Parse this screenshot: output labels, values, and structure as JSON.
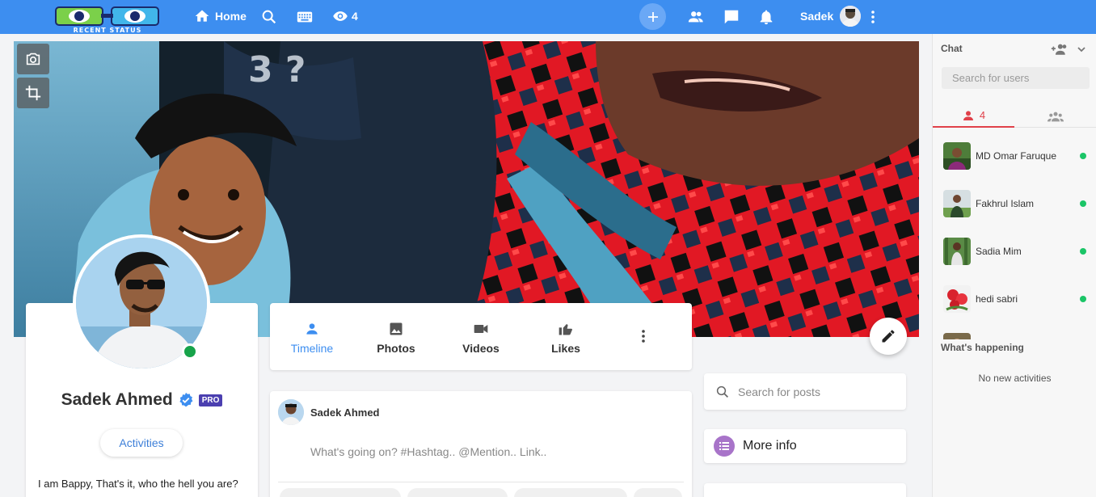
{
  "app": {
    "logo_text": "RECENT STATUS"
  },
  "nav": {
    "home_label": "Home",
    "views_count": "4",
    "user_name": "Sadek"
  },
  "profile": {
    "name": "Sadek Ahmed",
    "badge": "PRO",
    "activities_label": "Activities",
    "bio": "I am Bappy, That's it, who the hell you are?"
  },
  "tabs": [
    {
      "label": "Timeline",
      "icon": "person-icon",
      "active": true
    },
    {
      "label": "Photos",
      "icon": "photo-icon",
      "active": false
    },
    {
      "label": "Videos",
      "icon": "video-icon",
      "active": false
    },
    {
      "label": "Likes",
      "icon": "thumb-up-icon",
      "active": false
    }
  ],
  "publisher": {
    "user_name": "Sadek Ahmed",
    "placeholder": "What's going on? #Hashtag.. @Mention.. Link.."
  },
  "right_column": {
    "search_placeholder": "Search for posts",
    "more_info_label": "More info"
  },
  "chat": {
    "title": "Chat",
    "search_placeholder": "Search for users",
    "online_count": "4",
    "users": [
      {
        "name": "MD Omar Faruque",
        "online": true
      },
      {
        "name": "Fakhrul Islam",
        "online": true
      },
      {
        "name": "Sadia Mim",
        "online": true
      },
      {
        "name": "hedi sabri",
        "online": true
      }
    ],
    "happening_title": "What's happening",
    "no_activities": "No new activities"
  },
  "colors": {
    "brand_blue": "#3d8ef0",
    "online_green": "#1bc567",
    "chat_accent": "#e0414a",
    "pro_badge": "#4b3fb0"
  }
}
